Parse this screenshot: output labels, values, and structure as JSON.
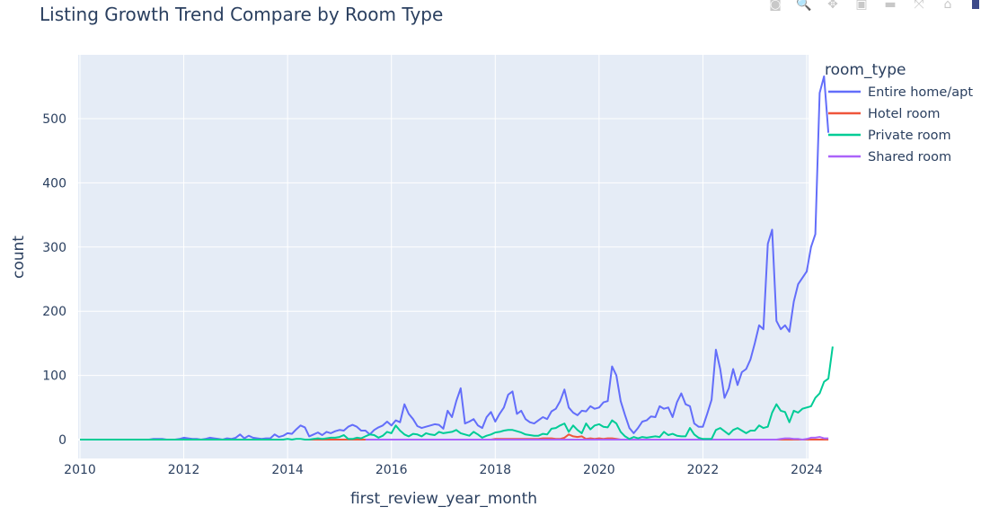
{
  "modebar": {
    "buttons": [
      {
        "name": "camera-icon",
        "glyph": "◙"
      },
      {
        "name": "zoom-icon",
        "glyph": "🔍"
      },
      {
        "name": "pan-icon",
        "glyph": "✥"
      },
      {
        "name": "zoom-in-icon",
        "glyph": "▣"
      },
      {
        "name": "zoom-out-icon",
        "glyph": "▬"
      },
      {
        "name": "autoscale-icon",
        "glyph": "⤧"
      },
      {
        "name": "reset-axes-icon",
        "glyph": "⌂"
      }
    ]
  },
  "chart_data": {
    "type": "line",
    "title": "Listing Growth Trend Compare by Room Type",
    "xlabel": "first_review_year_month",
    "ylabel": "count",
    "xlim": [
      "2010-01",
      "2024-02"
    ],
    "ylim": [
      -30,
      600
    ],
    "x_ticks": [
      "2010",
      "2012",
      "2014",
      "2016",
      "2018",
      "2020",
      "2022",
      "2024"
    ],
    "y_ticks": [
      0,
      100,
      200,
      300,
      400,
      500
    ],
    "grid": true,
    "legend": {
      "title": "room_type",
      "placement": "top-right-outside"
    },
    "x_start": "2010-01",
    "x_frequency": "monthly",
    "series": [
      {
        "name": "Entire home/apt",
        "color": "#636efa",
        "values": [
          0,
          0,
          0,
          0,
          0,
          0,
          0,
          0,
          0,
          0,
          0,
          0,
          0,
          0,
          0,
          0,
          0,
          1,
          1,
          1,
          0,
          0,
          0,
          1,
          3,
          2,
          1,
          1,
          0,
          1,
          3,
          2,
          1,
          0,
          2,
          1,
          3,
          8,
          2,
          6,
          3,
          2,
          1,
          2,
          2,
          8,
          4,
          6,
          10,
          9,
          16,
          22,
          19,
          5,
          8,
          11,
          7,
          12,
          10,
          13,
          15,
          14,
          20,
          23,
          20,
          14,
          14,
          8,
          15,
          19,
          22,
          28,
          22,
          30,
          27,
          55,
          40,
          32,
          21,
          18,
          20,
          22,
          24,
          23,
          17,
          45,
          35,
          60,
          80,
          25,
          28,
          32,
          22,
          18,
          35,
          43,
          28,
          40,
          50,
          70,
          75,
          40,
          45,
          32,
          27,
          25,
          30,
          35,
          32,
          44,
          48,
          60,
          78,
          50,
          42,
          38,
          45,
          44,
          52,
          48,
          50,
          58,
          60,
          114,
          100,
          60,
          38,
          18,
          10,
          18,
          28,
          30,
          36,
          35,
          52,
          48,
          50,
          35,
          58,
          72,
          55,
          52,
          25,
          20,
          20,
          40,
          62,
          140,
          110,
          65,
          80,
          110,
          85,
          105,
          110,
          125,
          150,
          178,
          172,
          305,
          327,
          185,
          172,
          178,
          168,
          215,
          242,
          252,
          262,
          300,
          320,
          540,
          566,
          478
        ]
      },
      {
        "name": "Hotel room",
        "color": "#ef553b",
        "values": [
          null,
          null,
          null,
          null,
          null,
          null,
          null,
          null,
          null,
          null,
          null,
          null,
          null,
          null,
          null,
          null,
          null,
          null,
          null,
          null,
          null,
          null,
          null,
          null,
          null,
          null,
          null,
          null,
          null,
          null,
          null,
          null,
          null,
          null,
          null,
          null,
          null,
          null,
          null,
          null,
          null,
          null,
          null,
          null,
          null,
          null,
          null,
          null,
          null,
          null,
          null,
          null,
          null,
          0,
          0,
          0,
          0,
          0,
          0,
          0,
          0,
          0,
          0,
          0,
          0,
          0,
          0,
          0,
          0,
          0,
          0,
          0,
          0,
          0,
          0,
          0,
          0,
          0,
          0,
          0,
          0,
          0,
          0,
          0,
          0,
          0,
          0,
          0,
          0,
          0,
          0,
          0,
          0,
          0,
          0,
          0,
          1,
          1,
          1,
          1,
          1,
          1,
          1,
          1,
          1,
          1,
          1,
          2,
          2,
          2,
          1,
          1,
          3,
          8,
          5,
          4,
          5,
          1,
          2,
          1,
          2,
          1,
          2,
          2,
          1,
          0,
          0,
          0,
          0,
          0,
          0,
          0,
          0,
          0,
          0,
          0,
          0,
          0,
          0,
          0,
          0,
          0,
          0,
          0,
          0,
          0,
          0,
          0,
          0,
          0,
          0,
          0,
          0,
          0,
          0,
          0,
          0,
          0,
          0,
          0,
          0,
          0,
          0,
          0,
          0,
          0,
          0,
          0,
          0,
          0,
          0,
          0,
          0,
          0
        ]
      },
      {
        "name": "Private room",
        "color": "#00cc96",
        "values": [
          0,
          0,
          0,
          0,
          0,
          0,
          0,
          0,
          0,
          0,
          0,
          0,
          0,
          0,
          0,
          0,
          0,
          0,
          0,
          0,
          0,
          0,
          0,
          0,
          0,
          0,
          0,
          0,
          0,
          0,
          0,
          0,
          0,
          0,
          0,
          0,
          0,
          0,
          0,
          0,
          0,
          0,
          0,
          0,
          0,
          0,
          0,
          0,
          1,
          0,
          1,
          1,
          0,
          0,
          1,
          2,
          1,
          2,
          3,
          3,
          4,
          7,
          1,
          1,
          3,
          2,
          5,
          8,
          7,
          3,
          6,
          12,
          10,
          22,
          14,
          8,
          5,
          9,
          8,
          5,
          10,
          8,
          7,
          12,
          10,
          11,
          12,
          15,
          10,
          8,
          6,
          12,
          8,
          3,
          6,
          8,
          11,
          12,
          14,
          15,
          15,
          13,
          11,
          8,
          7,
          6,
          6,
          9,
          8,
          17,
          18,
          22,
          25,
          12,
          22,
          15,
          10,
          25,
          16,
          22,
          24,
          20,
          19,
          30,
          25,
          12,
          5,
          1,
          4,
          2,
          4,
          3,
          4,
          5,
          4,
          12,
          7,
          9,
          6,
          5,
          5,
          18,
          8,
          3,
          1,
          1,
          1,
          15,
          18,
          13,
          8,
          15,
          18,
          14,
          10,
          14,
          14,
          22,
          18,
          20,
          42,
          55,
          45,
          43,
          27,
          45,
          42,
          48,
          50,
          52,
          65,
          72,
          90,
          95,
          145
        ]
      },
      {
        "name": "Shared room",
        "color": "#ab63fa",
        "values": [
          null,
          null,
          null,
          null,
          null,
          null,
          null,
          null,
          null,
          null,
          null,
          null,
          null,
          null,
          null,
          null,
          null,
          null,
          null,
          null,
          null,
          null,
          null,
          null,
          null,
          null,
          null,
          null,
          null,
          null,
          null,
          null,
          null,
          null,
          null,
          null,
          null,
          null,
          null,
          null,
          null,
          null,
          null,
          null,
          null,
          null,
          null,
          null,
          null,
          null,
          null,
          null,
          null,
          null,
          null,
          null,
          null,
          null,
          null,
          null,
          null,
          null,
          null,
          null,
          null,
          null,
          0,
          0,
          0,
          0,
          0,
          0,
          0,
          0,
          0,
          0,
          0,
          0,
          0,
          0,
          0,
          0,
          0,
          0,
          0,
          0,
          0,
          0,
          0,
          0,
          0,
          0,
          0,
          0,
          0,
          0,
          0,
          0,
          0,
          0,
          0,
          0,
          0,
          0,
          0,
          0,
          0,
          0,
          0,
          0,
          0,
          0,
          0,
          0,
          0,
          0,
          0,
          0,
          0,
          0,
          0,
          0,
          0,
          0,
          0,
          0,
          0,
          0,
          0,
          0,
          0,
          0,
          0,
          0,
          0,
          0,
          0,
          0,
          0,
          0,
          0,
          0,
          0,
          0,
          0,
          0,
          0,
          0,
          0,
          0,
          0,
          0,
          0,
          0,
          0,
          0,
          0,
          0,
          0,
          0,
          0,
          0,
          1,
          2,
          2,
          1,
          1,
          0,
          1,
          3,
          3,
          4,
          2,
          2
        ]
      }
    ]
  }
}
